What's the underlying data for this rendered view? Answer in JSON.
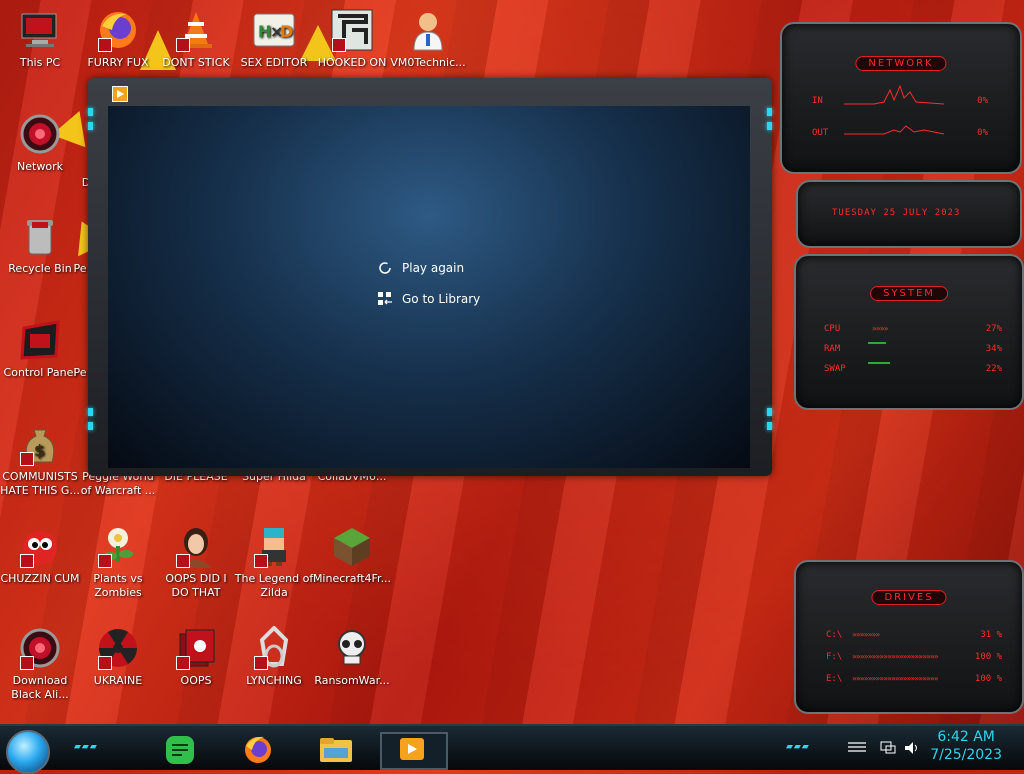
{
  "desktop_icons": [
    {
      "label": "This PC"
    },
    {
      "label": "FURRY FUX"
    },
    {
      "label": "DONT STICK"
    },
    {
      "label": "SEX EDITOR"
    },
    {
      "label": "HOOKED ON"
    },
    {
      "label": "VM0Technic..."
    },
    {
      "label": "Network"
    },
    {
      "label": "Recycle Bin"
    },
    {
      "label": "Control Panel"
    },
    {
      "label": "COMMUNISTS HATE THIS G..."
    },
    {
      "label": "Peggle World of Warcraft ..."
    },
    {
      "label": "DIE PLEASE"
    },
    {
      "label": "Super Hilda"
    },
    {
      "label": "CollabVM6..."
    },
    {
      "label": "CHUZZIN CUM"
    },
    {
      "label": "Plants vs Zombies"
    },
    {
      "label": "OOPS DID I DO THAT"
    },
    {
      "label": "The Legend of Zilda"
    },
    {
      "label": "Minecraft4Fr..."
    },
    {
      "label": "Download Black Ali..."
    },
    {
      "label": "UKRAINE"
    },
    {
      "label": "OOPS"
    },
    {
      "label": "LYNCHING"
    },
    {
      "label": "RansomWar..."
    },
    {
      "label": "Pe"
    },
    {
      "label": "Pe"
    },
    {
      "label": "D"
    }
  ],
  "player": {
    "play_again": "Play again",
    "go_to_library": "Go to Library"
  },
  "widgets": {
    "network": {
      "title": "NETWORK",
      "in_label": "IN",
      "out_label": "OUT",
      "in_value": "0%",
      "out_value": "0%"
    },
    "date": {
      "text": "TUESDAY 25 JULY 2023"
    },
    "system": {
      "title": "SYSTEM",
      "cpu_label": "CPU",
      "ram_label": "RAM",
      "swap_label": "SWAP",
      "cpu_value": "27%",
      "ram_value": "34%",
      "swap_value": "22%"
    },
    "drives": {
      "title": "DRIVES",
      "d1": "C:\\",
      "d2": "F:\\",
      "d3": "E:\\",
      "v1": "31 %",
      "v2": "100 %",
      "v3": "100 %"
    }
  },
  "taskbar": {
    "time": "6:42 AM",
    "date": "7/25/2023"
  },
  "colors": {
    "accent_cyan": "#29d7ee",
    "widget_red": "#ff2a2a",
    "desktop_red": "#d12a14"
  }
}
